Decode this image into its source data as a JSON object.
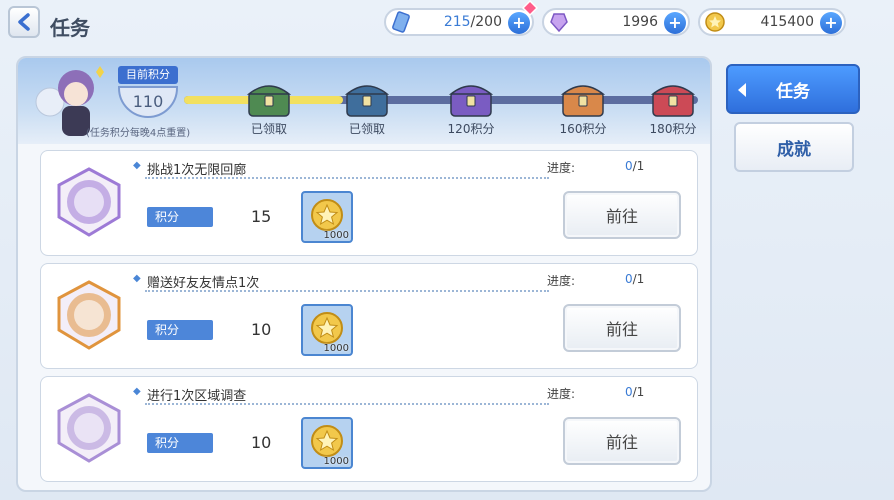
{
  "header": {
    "title": "任务"
  },
  "resources": {
    "stamina": {
      "current": "215",
      "max": "/200",
      "icon": "stamina-crystal-icon"
    },
    "jewels": {
      "value": "1996",
      "icon": "jewel-icon"
    },
    "mana": {
      "value": "415400",
      "icon": "coin-icon"
    },
    "plus_symbol": "+"
  },
  "mission_points": {
    "label": "目前积分",
    "value": "110",
    "reset_note": "(任务积分每晚4点重置)",
    "progress_ratio": 0.31,
    "milestones": [
      {
        "label": "已领取",
        "icon": "chest-green-opened-icon",
        "color": "#4f8a52"
      },
      {
        "label": "已领取",
        "icon": "chest-blue-opened-icon",
        "color": "#3f6e9c"
      },
      {
        "label": "120积分",
        "icon": "chest-purple-icon",
        "color": "#7a5cc2"
      },
      {
        "label": "160积分",
        "icon": "chest-orange-icon",
        "color": "#d9884a"
      },
      {
        "label": "180积分",
        "icon": "chest-red-icon",
        "color": "#cc4a56"
      }
    ]
  },
  "tasks": [
    {
      "name": "挑战1次无限回廊",
      "progress_label": "进度:",
      "progress_current": "0",
      "progress_total": "/1",
      "points_label": "积分",
      "points": "15",
      "reward_qty": "1000",
      "go_label": "前往",
      "emblem_color": "#9d7ad6"
    },
    {
      "name": "赠送好友友情点1次",
      "progress_label": "进度:",
      "progress_current": "0",
      "progress_total": "/1",
      "points_label": "积分",
      "points": "10",
      "reward_qty": "1000",
      "go_label": "前往",
      "emblem_color": "#e0943d"
    },
    {
      "name": "进行1次区域调查",
      "progress_label": "进度:",
      "progress_current": "0",
      "progress_total": "/1",
      "points_label": "积分",
      "points": "10",
      "reward_qty": "1000",
      "go_label": "前往",
      "emblem_color": "#a98fd6"
    }
  ],
  "side_tabs": {
    "missions": "任务",
    "achievements": "成就"
  },
  "colors": {
    "accent": "#2f6fdc",
    "points_bar": "#f2e060"
  }
}
